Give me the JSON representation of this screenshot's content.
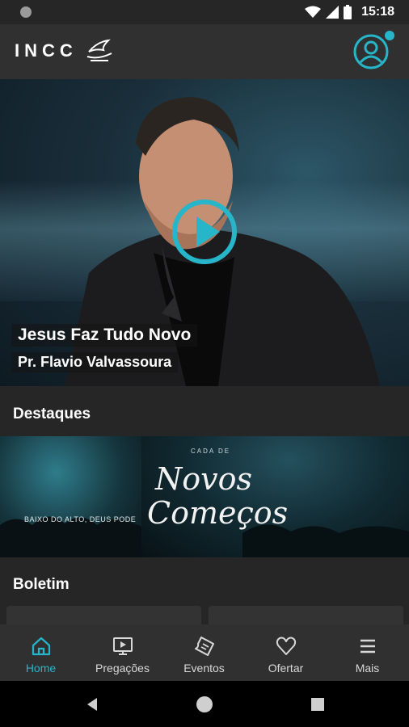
{
  "status_bar": {
    "time": "15:18"
  },
  "app_bar": {
    "logo_text": "INCC"
  },
  "hero": {
    "title": "Jesus Faz Tudo Novo",
    "subtitle": "Pr. Flavio Valvassoura"
  },
  "sections": {
    "highlights_title": "Destaques",
    "bulletin_title": "Boletim"
  },
  "banner": {
    "script_line1": "Novos",
    "script_line2": "Começos",
    "small_text": "CADA DE",
    "caption": "BAIXO DO ALTO, DEUS PODE"
  },
  "bottom_nav": {
    "items": [
      {
        "label": "Home",
        "icon": "home-icon",
        "active": true
      },
      {
        "label": "Pregações",
        "icon": "monitor-play-icon",
        "active": false
      },
      {
        "label": "Eventos",
        "icon": "ticket-icon",
        "active": false
      },
      {
        "label": "Ofertar",
        "icon": "heart-icon",
        "active": false
      },
      {
        "label": "Mais",
        "icon": "menu-icon",
        "active": false
      }
    ]
  },
  "colors": {
    "accent": "#26b5c9",
    "background": "#262626",
    "bar": "#303030"
  }
}
